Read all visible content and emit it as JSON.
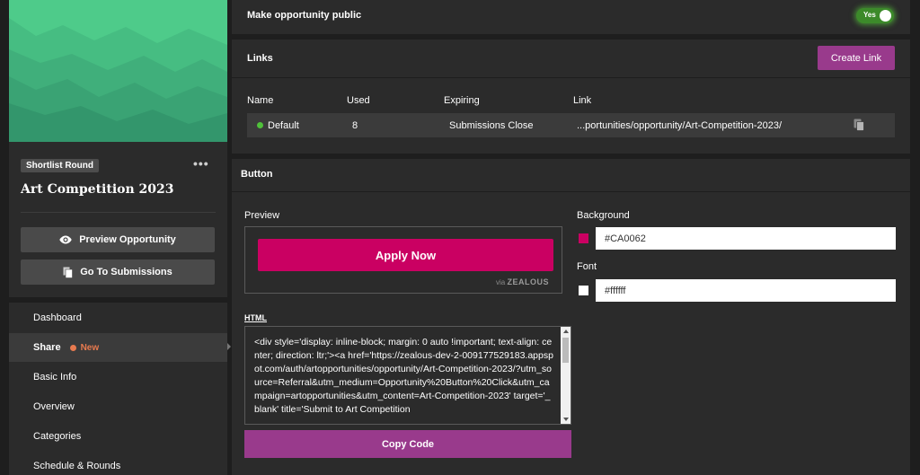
{
  "opportunity": {
    "round_badge": "Shortlist Round",
    "more_icon": "ellipsis-icon",
    "title": "Art Competition 2023",
    "buttons": {
      "preview": "Preview Opportunity",
      "submissions": "Go To Submissions"
    }
  },
  "nav": {
    "items": [
      {
        "label": "Dashboard"
      },
      {
        "label": "Share",
        "badge": "New",
        "active": true
      },
      {
        "label": "Basic Info"
      },
      {
        "label": "Overview"
      },
      {
        "label": "Categories"
      },
      {
        "label": "Schedule & Rounds"
      }
    ]
  },
  "public_toggle": {
    "label": "Make opportunity public",
    "state": "Yes"
  },
  "links": {
    "title": "Links",
    "create_button": "Create Link",
    "columns": [
      "Name",
      "Used",
      "Expiring",
      "Link"
    ],
    "rows": [
      {
        "name": "Default",
        "status": "active",
        "used": "8",
        "expiring": "Submissions Close",
        "link": "...portunities/opportunity/Art-Competition-2023/"
      }
    ]
  },
  "button_section": {
    "title": "Button",
    "preview_label": "Preview",
    "apply_label": "Apply Now",
    "via_prefix": "via",
    "via_brand": "ZEALOUS",
    "background_label": "Background",
    "background_value": "#CA0062",
    "font_label": "Font",
    "font_value": "#ffffff",
    "html_label": "HTML",
    "html_code": "<div style='display: inline-block; margin: 0 auto !important; text-align: center; direction: ltr;'><a href='https://zealous-dev-2-009177529183.appspot.com/auth/artopportunities/opportunity/Art-Competition-2023/?utm_source=Referral&utm_medium=Opportunity%20Button%20Click&utm_campaign=artopportunities&utm_content=Art-Competition-2023' target='_blank' title='Submit to Art Competition",
    "copy_button": "Copy Code"
  },
  "colors": {
    "accent_purple": "#993a8c",
    "apply_bg": "#CA0062",
    "toggle_green": "#3c8a2a",
    "new_badge": "#e87a4f",
    "status_dot": "#4fc13a"
  }
}
